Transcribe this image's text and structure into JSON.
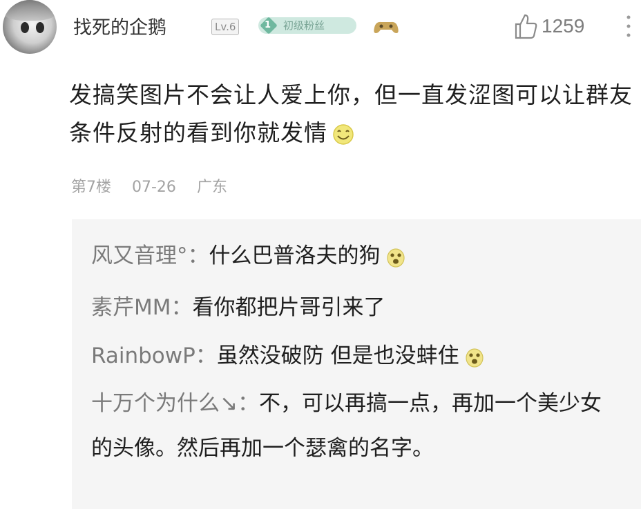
{
  "comment": {
    "username": "找死的企鹅",
    "level": "Lv.6",
    "fan_badge": {
      "num": "1",
      "label": "初级粉丝"
    },
    "like_count": "1259",
    "text": "发搞笑图片不会让人爱上你，但一直发涩图可以让群友条件反射的看到你就发情",
    "floor": "第7楼",
    "date": "07-26",
    "location": "广东"
  },
  "replies": [
    {
      "name": "风又音理°：",
      "text": "什么巴普洛夫的狗"
    },
    {
      "name": "素芹MM：",
      "text": "看你都把片哥引来了"
    },
    {
      "name": "RainbowP：",
      "text": "虽然没破防 但是也没蚌住"
    },
    {
      "name": "十万个为什么↘：",
      "text": "不，可以再搞一点，再加一个美少女的头像。然后再加一个瑟禽的名字。"
    }
  ],
  "colors": {
    "badge_bg": "#cfe9e0",
    "badge_text": "#7aa596",
    "reply_bg": "#f5f5f5"
  },
  "icons": [
    "thumb-up-icon",
    "more-vert-icon",
    "gamepad-icon",
    "smile-emoji-icon",
    "shock-emoji-icon"
  ]
}
